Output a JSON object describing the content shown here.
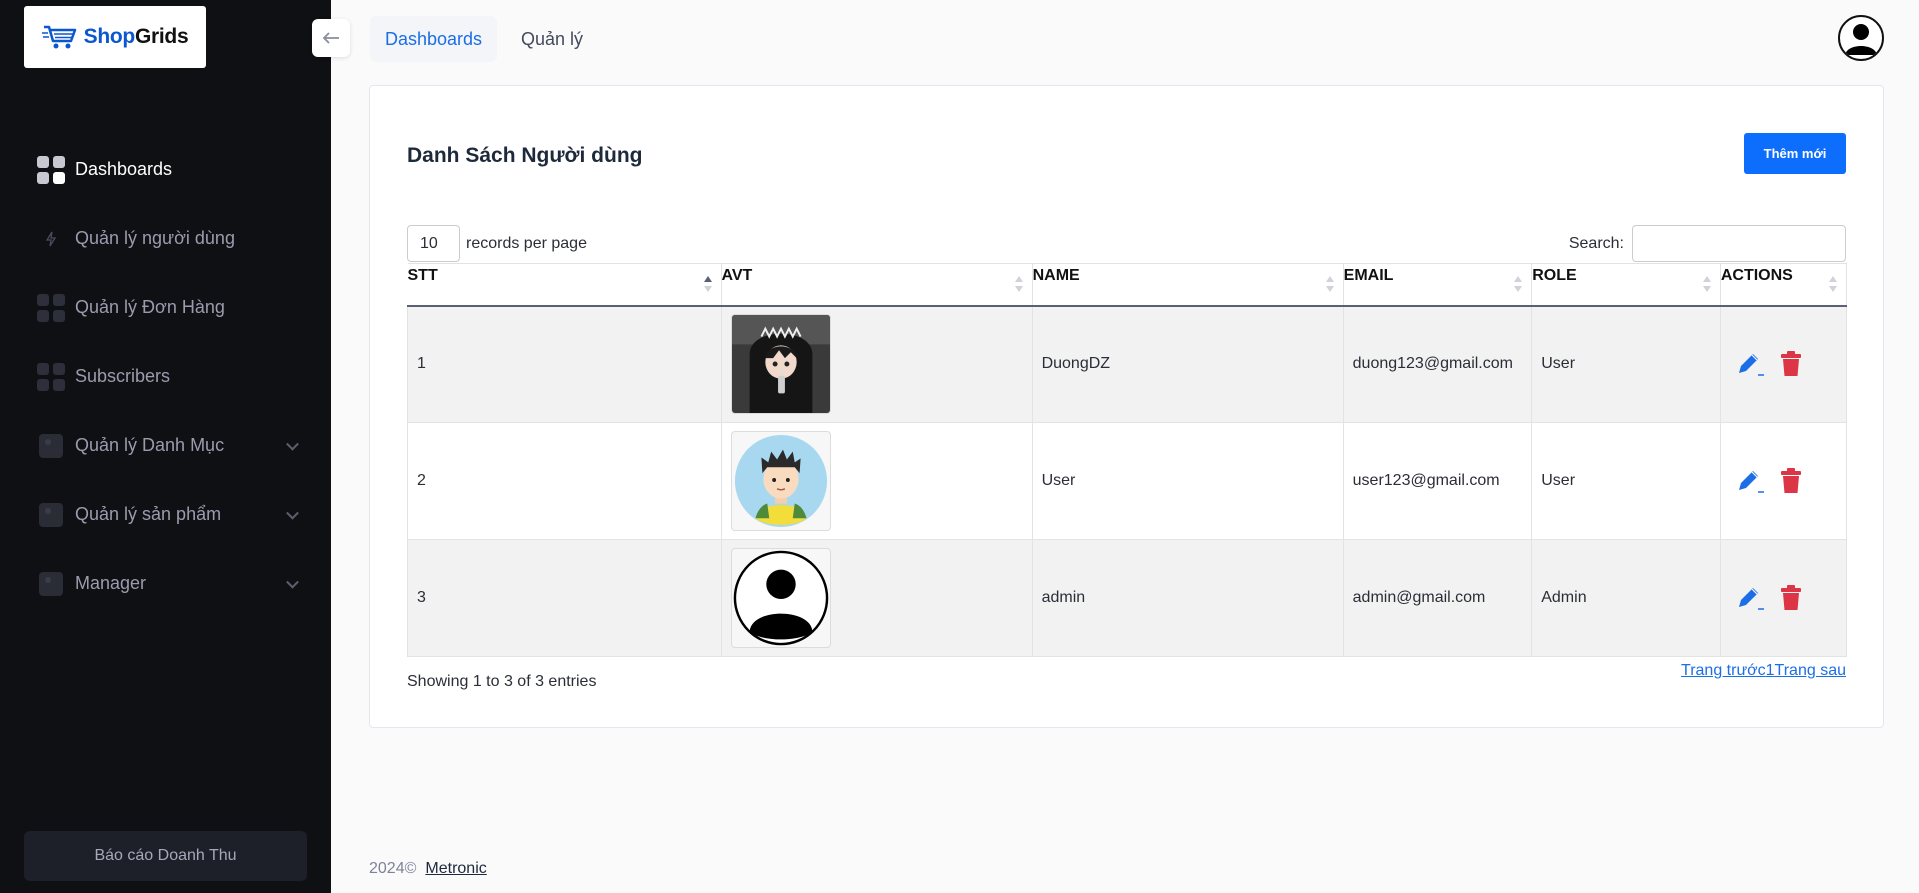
{
  "brand": {
    "part1": "Shop",
    "part2": "Grids"
  },
  "sidebar": {
    "items": [
      {
        "label": "Dashboards",
        "icon": "grid-icon",
        "active": true
      },
      {
        "label": "Quản lý người dùng",
        "icon": "lightning-icon"
      },
      {
        "label": "Quản lý Đơn Hàng",
        "icon": "grid-icon"
      },
      {
        "label": "Subscribers",
        "icon": "grid-icon"
      },
      {
        "label": "Quản lý Danh Mục",
        "icon": "user-square-icon",
        "expandable": true
      },
      {
        "label": "Quản lý sản phẩm",
        "icon": "user-square-icon",
        "expandable": true
      },
      {
        "label": "Manager",
        "icon": "user-square-icon",
        "expandable": true
      }
    ],
    "report_button": "Báo cáo Doanh Thu"
  },
  "header": {
    "tabs": [
      {
        "label": "Dashboards"
      },
      {
        "label": "Quản lý"
      }
    ]
  },
  "card": {
    "title": "Danh Sách Người dùng",
    "add_button": "Thêm mới",
    "records_per_page_value": "10",
    "records_per_page_label": "records per page",
    "search_label": "Search:",
    "search_value": ""
  },
  "table": {
    "columns": [
      "STT",
      "AVT",
      "NAME",
      "EMAIL",
      "ROLE",
      "ACTIONS"
    ],
    "rows": [
      {
        "stt": "1",
        "avatar": "anime-hoodie-avatar",
        "name": "DuongDZ",
        "email": "duong123@gmail.com",
        "role": "User"
      },
      {
        "stt": "2",
        "avatar": "cartoon-boy-avatar",
        "name": "User",
        "email": "user123@gmail.com",
        "role": "User"
      },
      {
        "stt": "3",
        "avatar": "default-user-avatar",
        "name": "admin",
        "email": "admin@gmail.com",
        "role": "Admin"
      }
    ]
  },
  "table_info": "Showing 1 to 3 of 3 entries",
  "pagination": {
    "prev": "Trang trước",
    "page": "1",
    "next": "Trang sau"
  },
  "footer": {
    "year": "2024©",
    "link": "Metronic"
  },
  "colors": {
    "sidebar_bg": "#0f1014",
    "primary": "#0d6efd",
    "delete": "#dc3545",
    "tab_active": "#1b6ee6"
  }
}
